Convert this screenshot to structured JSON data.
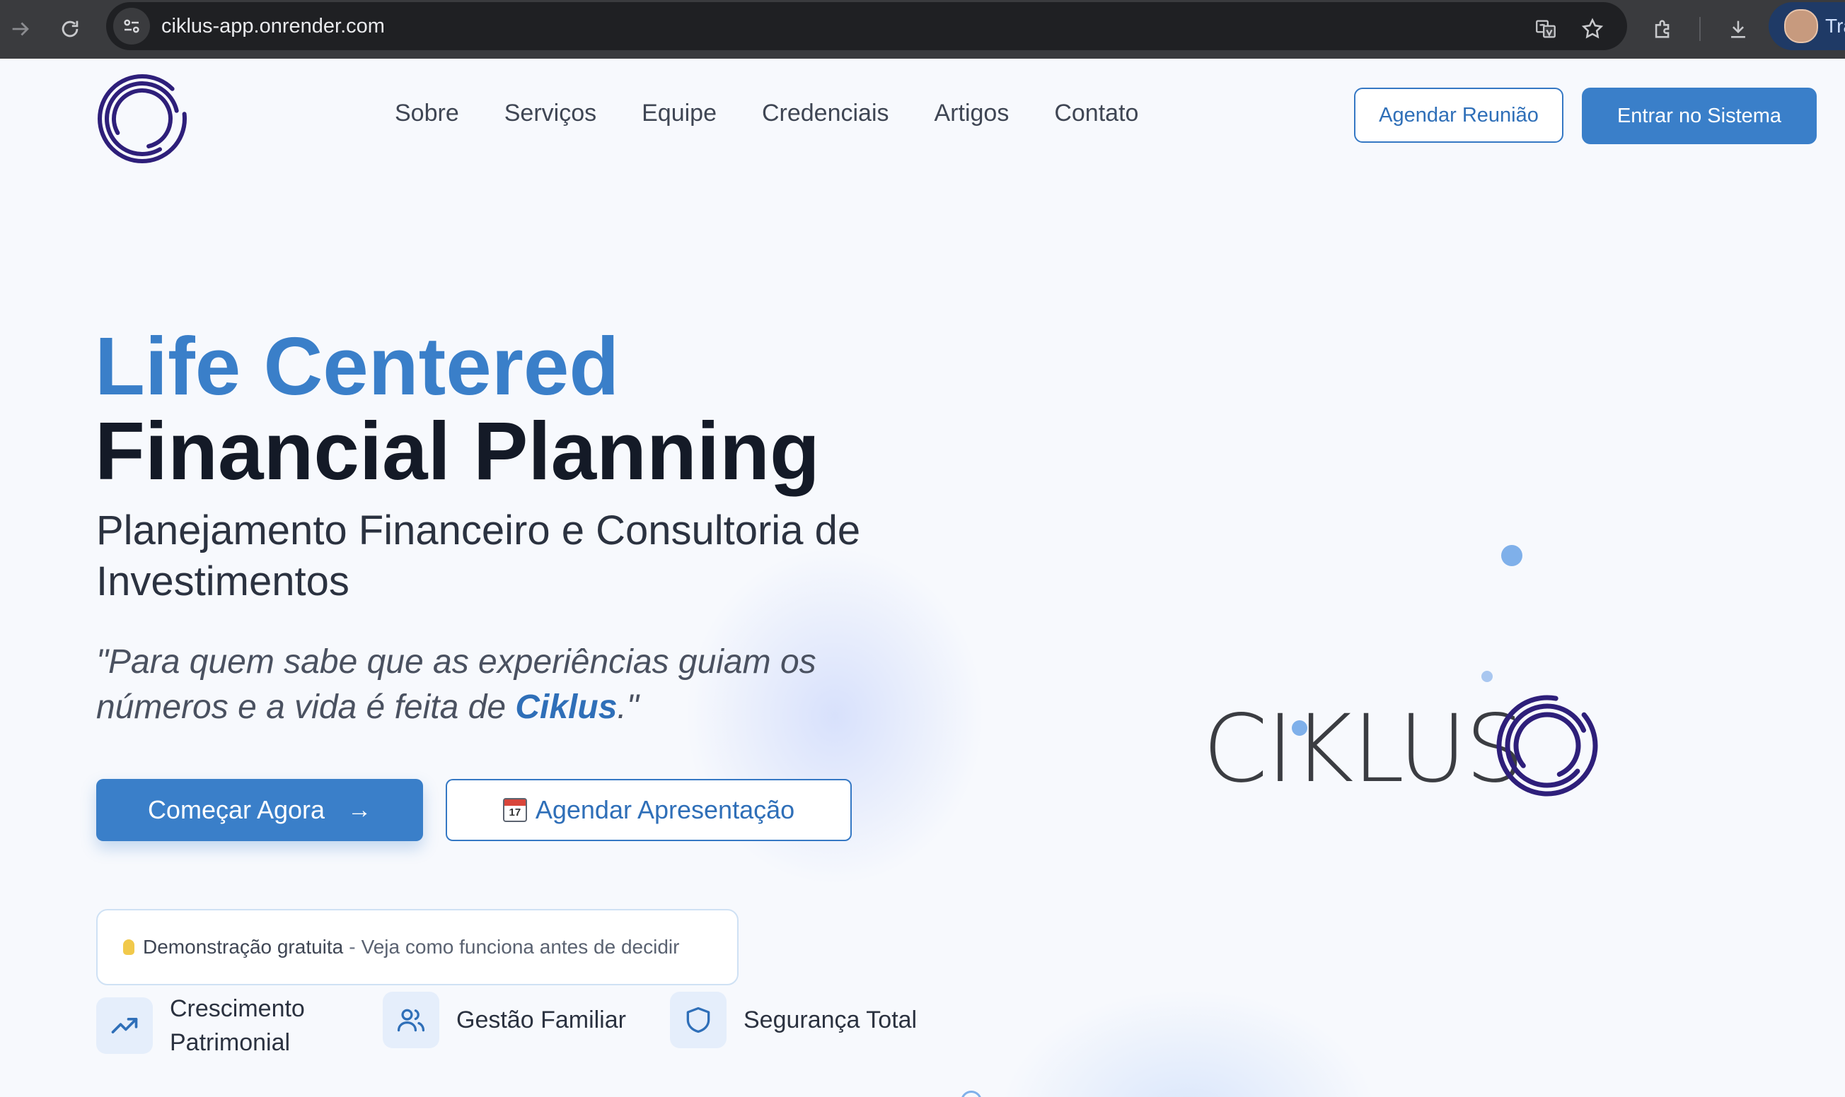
{
  "browser": {
    "url": "ciklus-app.onrender.com",
    "profile_name": "Tra"
  },
  "header": {
    "nav": [
      "Sobre",
      "Serviços",
      "Equipe",
      "Credenciais",
      "Artigos",
      "Contato"
    ],
    "schedule_meeting_label": "Agendar Reunião",
    "enter_system_label": "Entrar no Sistema"
  },
  "hero": {
    "title_line1": "Life Centered",
    "title_line2": "Financial Planning",
    "subtitle": "Planejamento Financeiro e Consultoria de Investimentos",
    "quote_prefix": "\"Para quem sabe que as experiências guiam os números e a vida é feita de ",
    "quote_brand": "Ciklus",
    "quote_suffix": ".\"",
    "primary_button": "Começar Agora",
    "primary_button_arrow": "→",
    "secondary_button": "Agendar Apresentação",
    "calendar_day": "17"
  },
  "demo": {
    "highlight": "Demonstração gratuita",
    "separator": "-",
    "text": "Veja como funciona antes de decidir"
  },
  "features": [
    {
      "label": "Crescimento Patrimonial",
      "icon": "trending-up-icon"
    },
    {
      "label": "Gestão Familiar",
      "icon": "users-icon"
    },
    {
      "label": "Segurança Total",
      "icon": "shield-icon"
    }
  ],
  "brand": {
    "logo_text": "CIKLUS"
  },
  "colors": {
    "accent": "#3a7fc9",
    "brand_purple": "#2e1f7a",
    "heading_dark": "#141a27"
  }
}
